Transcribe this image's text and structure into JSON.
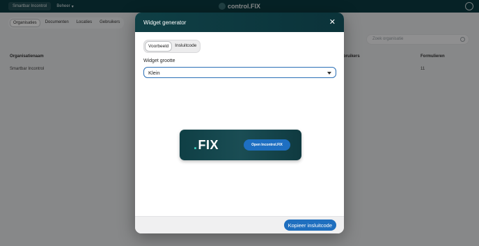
{
  "app": {
    "brand": "control.FIX",
    "workspace": "Smartbar Incontrol",
    "menu_label": "Beheer"
  },
  "bg_tabs": [
    "Organisaties",
    "Documenten",
    "Locaties",
    "Gebruikers"
  ],
  "search": {
    "placeholder": "Zoek organisatie"
  },
  "table": {
    "headers": {
      "name": "Organisatienaam",
      "users": "e gebruikers",
      "forms": "Formulieren"
    },
    "rows": [
      {
        "name": "Smartbar Incontrol",
        "forms": "11"
      }
    ]
  },
  "modal": {
    "title": "Widget generator",
    "tabs": [
      "Voorbeeld",
      "Insluitcode"
    ],
    "field_label": "Widget grootte",
    "select_value": "Klein",
    "widget": {
      "logo": "FIX",
      "button": "Open Incontrol.FIX"
    },
    "copy_button": "Kopieer insluitcode"
  },
  "colors": {
    "header": "#0f3f45",
    "primary": "#1f6fbf",
    "accent": "#3dd6c5"
  }
}
